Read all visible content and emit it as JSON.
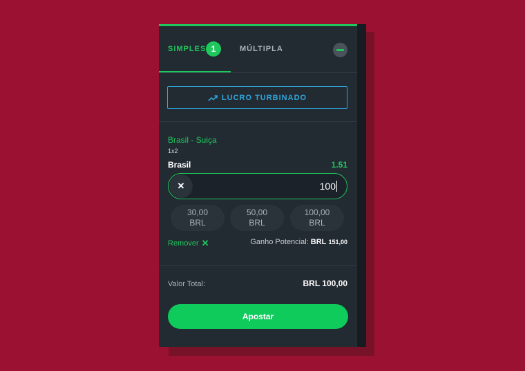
{
  "tabs": {
    "simples": "SIMPLES",
    "simples_count": "1",
    "multipla": "MÚLTIPLA"
  },
  "boost": {
    "label": "LUCRO TURBINADO",
    "icon": "trending-up-icon"
  },
  "bet": {
    "match": "Brasil - Suiça",
    "market": "1x2",
    "selection": "Brasil",
    "odds": "1.51",
    "stake": "100",
    "clear_symbol": "✕",
    "quick_stakes": [
      {
        "amount": "30,00",
        "currency": "BRL"
      },
      {
        "amount": "50,00",
        "currency": "BRL"
      },
      {
        "amount": "100,00",
        "currency": "BRL"
      }
    ],
    "remove_label": "Remover",
    "remove_symbol": "✕",
    "potential_label": "Ganho Potencial:",
    "potential_currency": "BRL",
    "potential_value": "151,00"
  },
  "summary": {
    "total_label": "Valor Total:",
    "total_value": "BRL  100,00"
  },
  "submit_label": "Apostar",
  "colors": {
    "background": "#9a1131",
    "panel": "#222a32",
    "accent_green": "#1fc85d",
    "accent_blue": "#2fa6dc"
  }
}
